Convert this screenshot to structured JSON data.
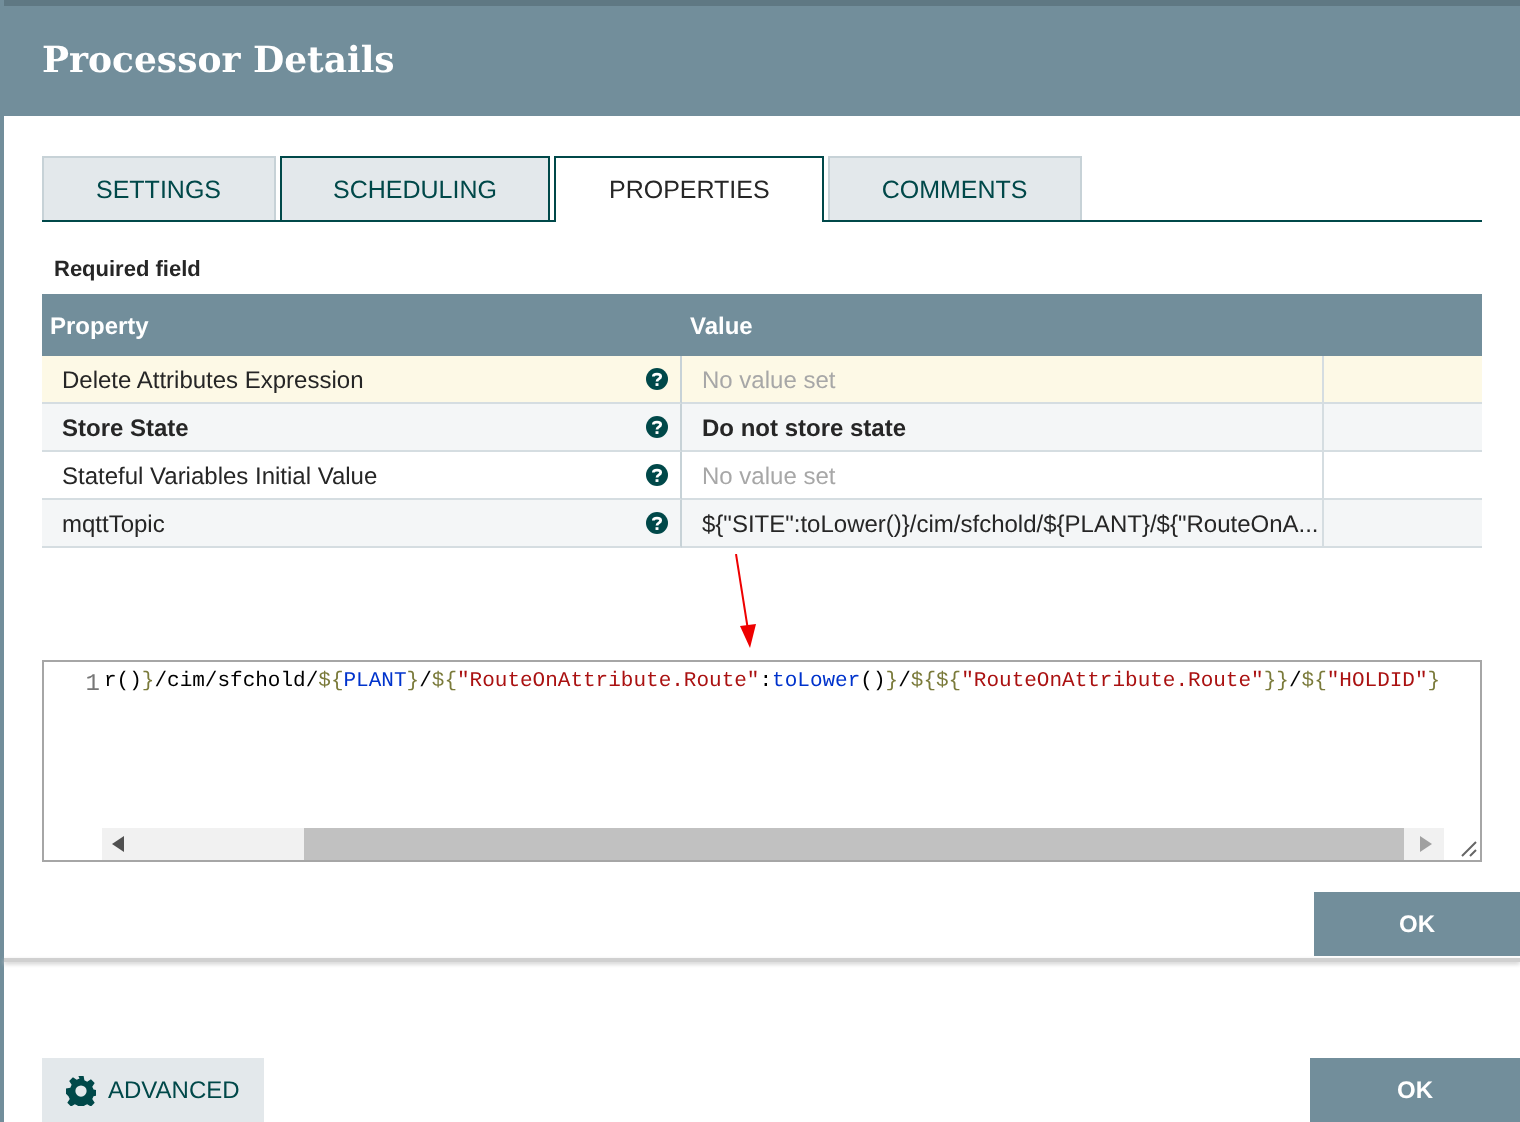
{
  "dialog": {
    "title": "Processor Details"
  },
  "tabs": [
    {
      "label": "SETTINGS",
      "selected": false
    },
    {
      "label": "SCHEDULING",
      "selected": false
    },
    {
      "label": "PROPERTIES",
      "selected": true
    },
    {
      "label": "COMMENTS",
      "selected": false
    }
  ],
  "required_note": "Required field",
  "table": {
    "columns": [
      "Property",
      "Value"
    ],
    "rows": [
      {
        "property": "Delete Attributes Expression",
        "value": "No value set",
        "value_set": false,
        "required": false,
        "selected": true
      },
      {
        "property": "Store State",
        "value": "Do not store state",
        "value_set": true,
        "required": true,
        "selected": false
      },
      {
        "property": "Stateful Variables Initial Value",
        "value": "No value set",
        "value_set": false,
        "required": false,
        "selected": false
      },
      {
        "property": "mqttTopic",
        "value": "${\"SITE\":toLower()}/cim/sfchold/${PLANT}/${\"RouteOnA...",
        "value_set": true,
        "required": false,
        "selected": false
      }
    ]
  },
  "editor": {
    "line_number": "1",
    "tokens": [
      {
        "kind": "plain",
        "text": "r()"
      },
      {
        "kind": "punct",
        "text": "}"
      },
      {
        "kind": "plain",
        "text": "/cim/sfchold/"
      },
      {
        "kind": "punct",
        "text": "${"
      },
      {
        "kind": "var",
        "text": "PLANT"
      },
      {
        "kind": "punct",
        "text": "}"
      },
      {
        "kind": "plain",
        "text": "/"
      },
      {
        "kind": "punct",
        "text": "${"
      },
      {
        "kind": "string",
        "text": "\"RouteOnAttribute.Route\""
      },
      {
        "kind": "plain",
        "text": ":"
      },
      {
        "kind": "func",
        "text": "toLower"
      },
      {
        "kind": "plain",
        "text": "()"
      },
      {
        "kind": "punct",
        "text": "}"
      },
      {
        "kind": "plain",
        "text": "/"
      },
      {
        "kind": "punct",
        "text": "${${"
      },
      {
        "kind": "string",
        "text": "\"RouteOnAttribute.Route\""
      },
      {
        "kind": "punct",
        "text": "}}"
      },
      {
        "kind": "plain",
        "text": "/"
      },
      {
        "kind": "punct",
        "text": "${"
      },
      {
        "kind": "string",
        "text": "\"HOLDID\""
      },
      {
        "kind": "punct",
        "text": "}"
      }
    ],
    "ok_button": "OK"
  },
  "footer": {
    "advanced_button": "ADVANCED",
    "ok_button": "OK"
  }
}
